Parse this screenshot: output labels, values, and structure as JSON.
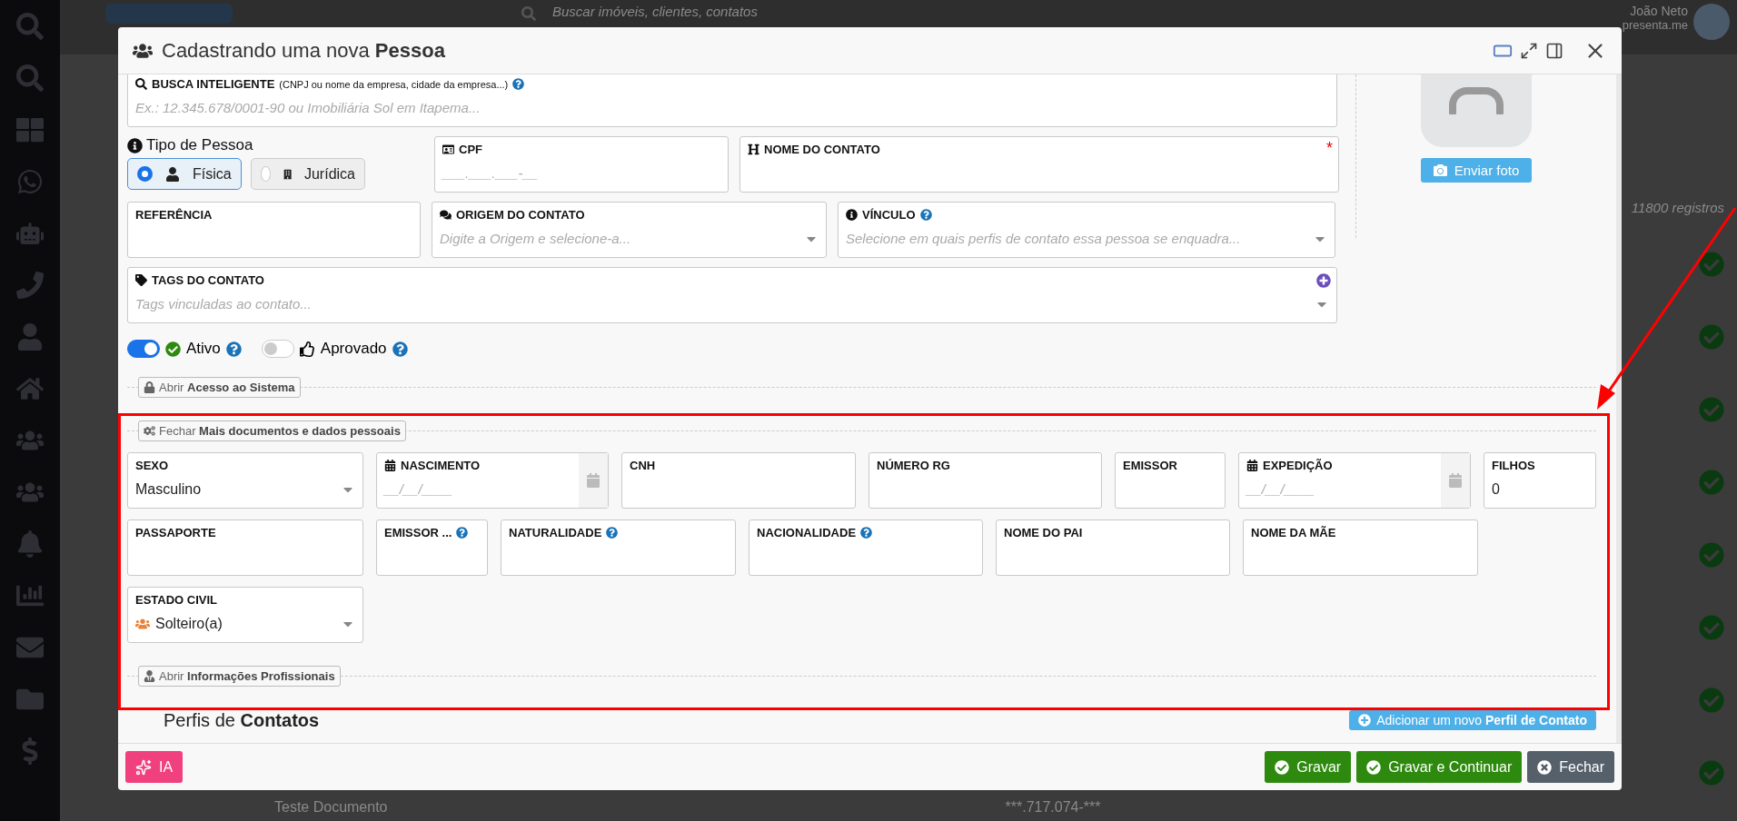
{
  "app": {
    "search_placeholder": "Buscar imóveis, clientes, contatos",
    "user_name": "João Neto",
    "user_site": "presenta.me",
    "records": "11800 registros",
    "row_name": "Teste Documento",
    "row_text": "***.717.074-***"
  },
  "modal": {
    "title": "Cadastrando uma nova **Pessoa**"
  },
  "smart_search": {
    "label": "BUSCA INTELIGENTE",
    "hint": "(CNPJ ou nome da empresa, cidade da empresa...)",
    "placeholder": "Ex.: 12.345.678/0001-90 ou Imobiliária Sol em Itapema..."
  },
  "person_type": {
    "label": "Tipo de Pessoa",
    "options": [
      {
        "label": "Física",
        "selected": true
      },
      {
        "label": "Jurídica",
        "selected": false
      }
    ]
  },
  "main_fields": [
    {
      "kind": "text",
      "label": "CPF",
      "placeholder": "___.___.___-__"
    },
    {
      "kind": "text",
      "label": "NOME DO CONTATO",
      "required_mark": "*"
    },
    {
      "kind": "text",
      "label": "REFERÊNCIA"
    },
    {
      "kind": "select",
      "label": "ORIGEM DO CONTATO",
      "placeholder": "Digite a Origem e selecione-a..."
    },
    {
      "kind": "select",
      "label": "VÍNCULO",
      "help": true,
      "placeholder": "Selecione em quais perfis de contato essa pessoa se enquadra..."
    },
    {
      "kind": "select",
      "label": "TAGS DO CONTATO",
      "add": true,
      "placeholder": "Tags vinculadas ao contato..."
    }
  ],
  "toggles": [
    {
      "label": "Ativo",
      "on": true
    },
    {
      "label": "Aprovado",
      "on": false
    }
  ],
  "access_section": {
    "label": "Abrir **Acesso ao Sistema**"
  },
  "documents_section": {
    "label": "Fechar **Mais documentos e dados pessoais**",
    "rows": [
      [
        {
          "kind": "select",
          "label": "SEXO",
          "value": "Masculino"
        },
        {
          "kind": "date",
          "label": "NASCIMENTO",
          "placeholder": "__/__/____"
        },
        {
          "kind": "text",
          "label": "CNH"
        },
        {
          "kind": "text",
          "label": "NÚMERO RG"
        },
        {
          "kind": "text",
          "label": "EMISSOR"
        },
        {
          "kind": "date",
          "label": "EXPEDIÇÃO",
          "placeholder": "__/__/____"
        },
        {
          "kind": "text",
          "label": "FILHOS",
          "value": "0"
        }
      ],
      [
        {
          "kind": "text",
          "label": "PASSAPORTE"
        },
        {
          "kind": "text",
          "label": "EMISSOR ...",
          "help": true
        },
        {
          "kind": "text",
          "label": "NATURALIDADE",
          "help": true
        },
        {
          "kind": "text",
          "label": "NACIONALIDADE",
          "help": true
        },
        {
          "kind": "text",
          "label": "NOME DO PAI"
        },
        {
          "kind": "text",
          "label": "NOME DA MÃE"
        }
      ],
      [
        {
          "kind": "select",
          "label": "ESTADO CIVIL",
          "value": "Solteiro(a)",
          "value_icon": true
        }
      ]
    ]
  },
  "professional_section": {
    "label": "Abrir **Informações Profissionais**"
  },
  "profiles": {
    "title": "Perfis de **Contatos**",
    "add_button": "Adicionar um novo **Perfil de Contato**"
  },
  "photo": {
    "button": "Enviar foto"
  },
  "footer": {
    "ai_button": "IA",
    "buttons": [
      {
        "kind": "save",
        "label": "Gravar"
      },
      {
        "kind": "save",
        "label": "Gravar e Continuar"
      },
      {
        "kind": "close",
        "label": "Fechar"
      }
    ]
  }
}
